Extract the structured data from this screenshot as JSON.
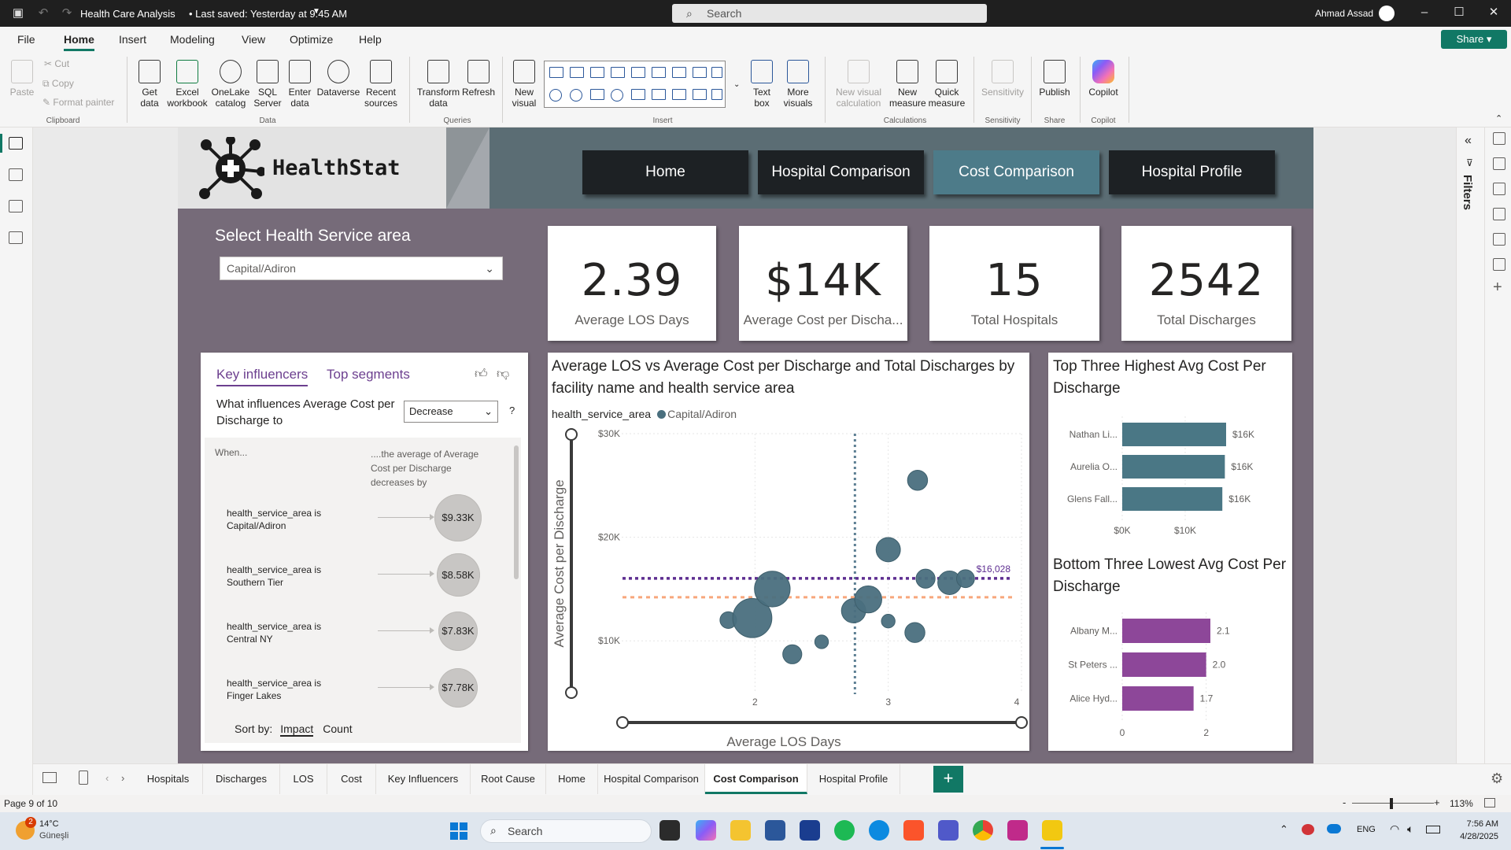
{
  "titlebar": {
    "title": "Health Care Analysis",
    "saved_status": "• Last saved: Yesterday at 9:45 AM",
    "search_placeholder": "Search",
    "user_name": "Ahmad Assad"
  },
  "menu": {
    "items": [
      "File",
      "Home",
      "Insert",
      "Modeling",
      "View",
      "Optimize",
      "Help"
    ],
    "active": "Home",
    "share_label": "Share"
  },
  "ribbon": {
    "clipboard": {
      "paste": "Paste",
      "cut": "Cut",
      "copy": "Copy",
      "format_painter": "Format painter",
      "group": "Clipboard"
    },
    "data": {
      "get_data": [
        "Get",
        "data"
      ],
      "excel": [
        "Excel",
        "workbook"
      ],
      "onelake": [
        "OneLake",
        "catalog"
      ],
      "sql": [
        "SQL",
        "Server"
      ],
      "enter": [
        "Enter",
        "data"
      ],
      "dataverse": "Dataverse",
      "recent": [
        "Recent",
        "sources"
      ],
      "group": "Data"
    },
    "queries": {
      "transform": [
        "Transform",
        "data"
      ],
      "refresh": "Refresh",
      "group": "Queries"
    },
    "insert": {
      "new_visual": [
        "New",
        "visual"
      ],
      "text_box": [
        "Text",
        "box"
      ],
      "more_visuals": [
        "More",
        "visuals"
      ],
      "group": "Insert"
    },
    "calculations": {
      "new_visual_calc": [
        "New visual",
        "calculation"
      ],
      "new_measure": [
        "New",
        "measure"
      ],
      "quick_measure": [
        "Quick",
        "measure"
      ],
      "group": "Calculations"
    },
    "sensitivity": {
      "label": "Sensitivity",
      "group": "Sensitivity"
    },
    "share": {
      "publish": "Publish",
      "group": "Share"
    },
    "copilot": {
      "label": "Copilot",
      "group": "Copilot"
    }
  },
  "report": {
    "logo_text": "HealthStat",
    "nav_tabs": [
      "Home",
      "Hospital Comparison",
      "Cost Comparison",
      "Hospital Profile"
    ],
    "active_nav": "Cost Comparison",
    "selector_label": "Select Health Service area",
    "selector_value": "Capital/Adiron",
    "cards": [
      {
        "value": "2.39",
        "label": "Average LOS Days"
      },
      {
        "value": "$14K",
        "label": "Average Cost per Discha..."
      },
      {
        "value": "15",
        "label": "Total Hospitals"
      },
      {
        "value": "2542",
        "label": "Total Discharges"
      }
    ]
  },
  "key_influencers": {
    "tabs": [
      "Key influencers",
      "Top segments"
    ],
    "question": "What influences Average Cost per Discharge to",
    "direction": "Decrease",
    "help": "?",
    "when_header": "When...",
    "then_header": "....the average of Average Cost per Discharge decreases by",
    "rows": [
      {
        "label": "health_service_area is Capital/Adiron",
        "value": "$9.33K",
        "impact": 9.33
      },
      {
        "label": "health_service_area is Southern Tier",
        "value": "$8.58K",
        "impact": 8.58
      },
      {
        "label": "health_service_area is Central NY",
        "value": "$7.83K",
        "impact": 7.83
      },
      {
        "label": "health_service_area is Finger Lakes",
        "value": "$7.78K",
        "impact": 7.78
      }
    ],
    "sort_by": "Sort by:",
    "sort_impact": "Impact",
    "sort_count": "Count"
  },
  "chart_data": [
    {
      "type": "scatter",
      "title": "Average LOS vs Average Cost per Discharge and Total Discharges by facility name and health service area",
      "legend_title": "health_service_area",
      "legend": [
        "Capital/Adiron"
      ],
      "xlabel": "Average LOS Days",
      "ylabel": "Average Cost per Discharge",
      "xlim": [
        1.0,
        4.0
      ],
      "ylim": [
        5000,
        30000
      ],
      "x_ticks": [
        "2",
        "3",
        "4"
      ],
      "y_ticks": [
        "$10K",
        "$20K",
        "$30K"
      ],
      "reference_line_label": "$16,028",
      "reference_line_value": 16028,
      "average_line_value": 14200,
      "x_average_line": 2.75,
      "points": [
        {
          "x": 1.8,
          "y": 12000,
          "size": 4
        },
        {
          "x": 1.98,
          "y": 12200,
          "size": 40
        },
        {
          "x": 2.13,
          "y": 15000,
          "size": 32
        },
        {
          "x": 2.28,
          "y": 8700,
          "size": 6
        },
        {
          "x": 2.5,
          "y": 9900,
          "size": 2
        },
        {
          "x": 2.74,
          "y": 12900,
          "size": 12
        },
        {
          "x": 2.85,
          "y": 14000,
          "size": 16
        },
        {
          "x": 3.0,
          "y": 18800,
          "size": 12
        },
        {
          "x": 3.0,
          "y": 11900,
          "size": 2
        },
        {
          "x": 3.2,
          "y": 10800,
          "size": 7
        },
        {
          "x": 3.22,
          "y": 25500,
          "size": 7
        },
        {
          "x": 3.28,
          "y": 16000,
          "size": 6
        },
        {
          "x": 3.46,
          "y": 15600,
          "size": 11
        },
        {
          "x": 3.58,
          "y": 16000,
          "size": 5
        }
      ]
    },
    {
      "type": "bar",
      "orientation": "horizontal",
      "title": "Top Three Highest Avg Cost Per Discharge",
      "categories": [
        "Nathan Li...",
        "Aurelia O...",
        "Glens Fall..."
      ],
      "values": [
        16500,
        16300,
        15900
      ],
      "data_labels": [
        "$16K",
        "$16K",
        "$16K"
      ],
      "x_ticks": [
        "$0K",
        "$10K"
      ],
      "xlim": [
        0,
        20000
      ],
      "color": "#4a7785"
    },
    {
      "type": "bar",
      "orientation": "horizontal",
      "title": "Bottom Three Lowest Avg Cost Per Discharge",
      "categories": [
        "Albany M...",
        "St Peters ...",
        "Alice Hyd..."
      ],
      "values": [
        2.1,
        2.0,
        1.7
      ],
      "data_labels": [
        "2.1",
        "2.0",
        "1.7"
      ],
      "x_ticks": [
        "0",
        "2"
      ],
      "xlim": [
        0,
        3
      ],
      "color": "#8d4799"
    }
  ],
  "right_pane": {
    "filters_label": "Filters"
  },
  "page_tabs": {
    "tabs": [
      "Hospitals",
      "Discharges",
      "LOS",
      "Cost",
      "Key Influencers",
      "Root Cause",
      "Home",
      "Hospital Comparison",
      "Cost Comparison",
      "Hospital Profile"
    ],
    "active": "Cost Comparison",
    "add": "+"
  },
  "status": {
    "page": "Page 9 of 10",
    "zoom": "113%",
    "zoom_minus": "-",
    "zoom_plus": "+"
  },
  "taskbar": {
    "weather_temp": "14°C",
    "weather_desc": "Güneşli",
    "weather_badge": "2",
    "search_placeholder": "Search",
    "lang": "ENG",
    "time": "7:56 AM",
    "date": "4/28/2025"
  }
}
